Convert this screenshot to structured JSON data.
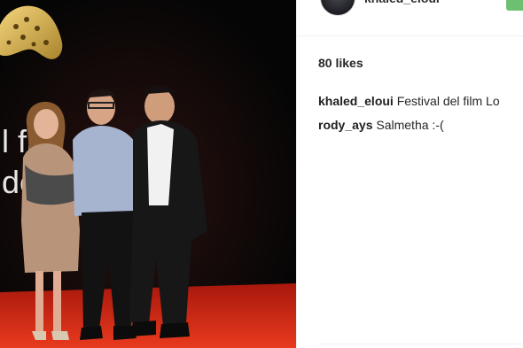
{
  "post": {
    "header_username": "khaled_eloui",
    "likes": "80 likes",
    "caption_user": "khaled_eloui",
    "caption_text": "Festival del film Lo",
    "comment_user": "rody_ays",
    "comment_text": "Salmetha :-("
  },
  "photo": {
    "backdrop_text_1": "l fi",
    "backdrop_text_2": "de"
  },
  "colors": {
    "follow_button": "#6cc070",
    "backdrop": "#070707",
    "carpet": "#c42010"
  }
}
